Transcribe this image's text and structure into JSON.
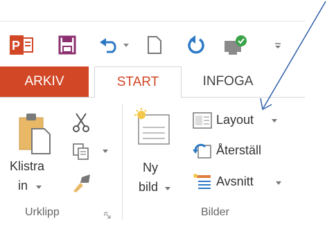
{
  "qat": {
    "icons": [
      "powerpoint-icon",
      "save-icon",
      "undo-icon",
      "new-icon",
      "redo-icon",
      "publish-icon",
      "customize-icon"
    ]
  },
  "tabs": [
    {
      "label": "ARKIV"
    },
    {
      "label": "START"
    },
    {
      "label": "INFOGA"
    }
  ],
  "clipboard": {
    "paste_line1": "Klistra",
    "paste_line2": "in",
    "group_label": "Urklipp"
  },
  "slides": {
    "new_line1": "Ny",
    "new_line2": "bild",
    "layout": "Layout",
    "reset": "Återställ",
    "section": "Avsnitt",
    "group_label": "Bilder"
  },
  "colors": {
    "accent": "#d24726",
    "save": "#8b2f6e",
    "undo": "#2b79c5",
    "arrow": "#2e5fa8"
  }
}
